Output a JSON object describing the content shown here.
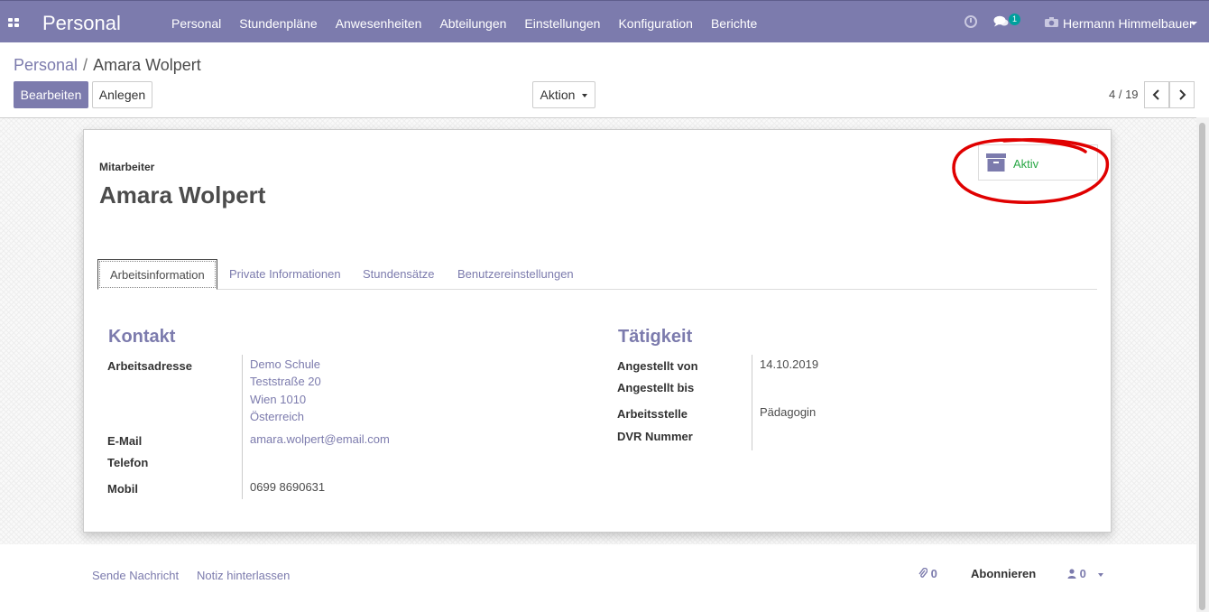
{
  "navbar": {
    "app_title": "Personal",
    "menu": [
      "Personal",
      "Stundenpläne",
      "Anwesenheiten",
      "Abteilungen",
      "Einstellungen",
      "Konfiguration",
      "Berichte"
    ],
    "chat_count": "1",
    "user_name": "Hermann Himmelbauer",
    "color": "#7c7bad"
  },
  "breadcrumb": {
    "parent": "Personal",
    "separator": "/",
    "current": "Amara Wolpert"
  },
  "toolbar": {
    "edit_label": "Bearbeiten",
    "create_label": "Anlegen",
    "action_label": "Aktion",
    "pager": "4 / 19"
  },
  "form": {
    "employee_label": "Mitarbeiter",
    "employee_name": "Amara Wolpert",
    "active_label": "Aktiv",
    "tabs": [
      "Arbeitsinformation",
      "Private Informationen",
      "Stundensätze",
      "Benutzereinstellungen"
    ],
    "contact": {
      "title": "Kontakt",
      "address_label": "Arbeitsadresse",
      "address_lines": [
        "Demo Schule",
        "Teststraße 20",
        "Wien 1010",
        "Österreich"
      ],
      "email_label": "E-Mail",
      "email_value": "amara.wolpert@email.com",
      "phone_label": "Telefon",
      "mobile_label": "Mobil",
      "mobile_value": "0699 8690631"
    },
    "activity": {
      "title": "Tätigkeit",
      "hired_from_label": "Angestellt von",
      "hired_from_value": "14.10.2019",
      "hired_until_label": "Angestellt bis",
      "job_label": "Arbeitsstelle",
      "job_value": "Pädagogin",
      "dvr_label": "DVR Nummer"
    }
  },
  "chatter": {
    "send_message": "Sende Nachricht",
    "log_note": "Notiz hinterlassen",
    "attachments": "0",
    "follow": "Abonnieren",
    "followers": "0"
  },
  "icons": [
    "apps-icon",
    "clock-icon",
    "chat-icon",
    "user-icon",
    "archive-icon",
    "paperclip-icon",
    "person-icon",
    "chevron-left-icon",
    "chevron-right-icon"
  ],
  "colors": {
    "brand": "#7c7bad",
    "active": "#28a745",
    "annotation": "#e00000"
  }
}
